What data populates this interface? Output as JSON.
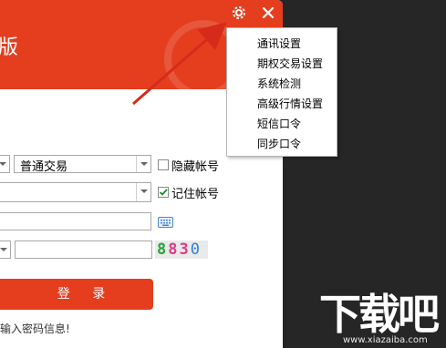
{
  "header": {
    "title": "版"
  },
  "trade_type": {
    "value": "普通交易"
  },
  "remember_options": {
    "hide_account_label": "隐藏帐号",
    "remember_account_label": "记住帐号"
  },
  "captcha": {
    "chars": [
      "8",
      "8",
      "3",
      "0"
    ],
    "colors": [
      "#2aa33a",
      "#e23b8a",
      "#e23b8a",
      "#2f7fd6"
    ]
  },
  "login": {
    "label": "登 录"
  },
  "hint": "输入密码信息!",
  "menu": {
    "items": [
      "通讯设置",
      "期权交易设置",
      "系统检测",
      "高级行情设置",
      "短信口令",
      "同步口令"
    ]
  },
  "watermark": {
    "text": "下载吧",
    "url": "www.xiazaiba.com"
  },
  "colors": {
    "accent": "#e43e1f",
    "annotation_arrow": "#d62b1a"
  }
}
